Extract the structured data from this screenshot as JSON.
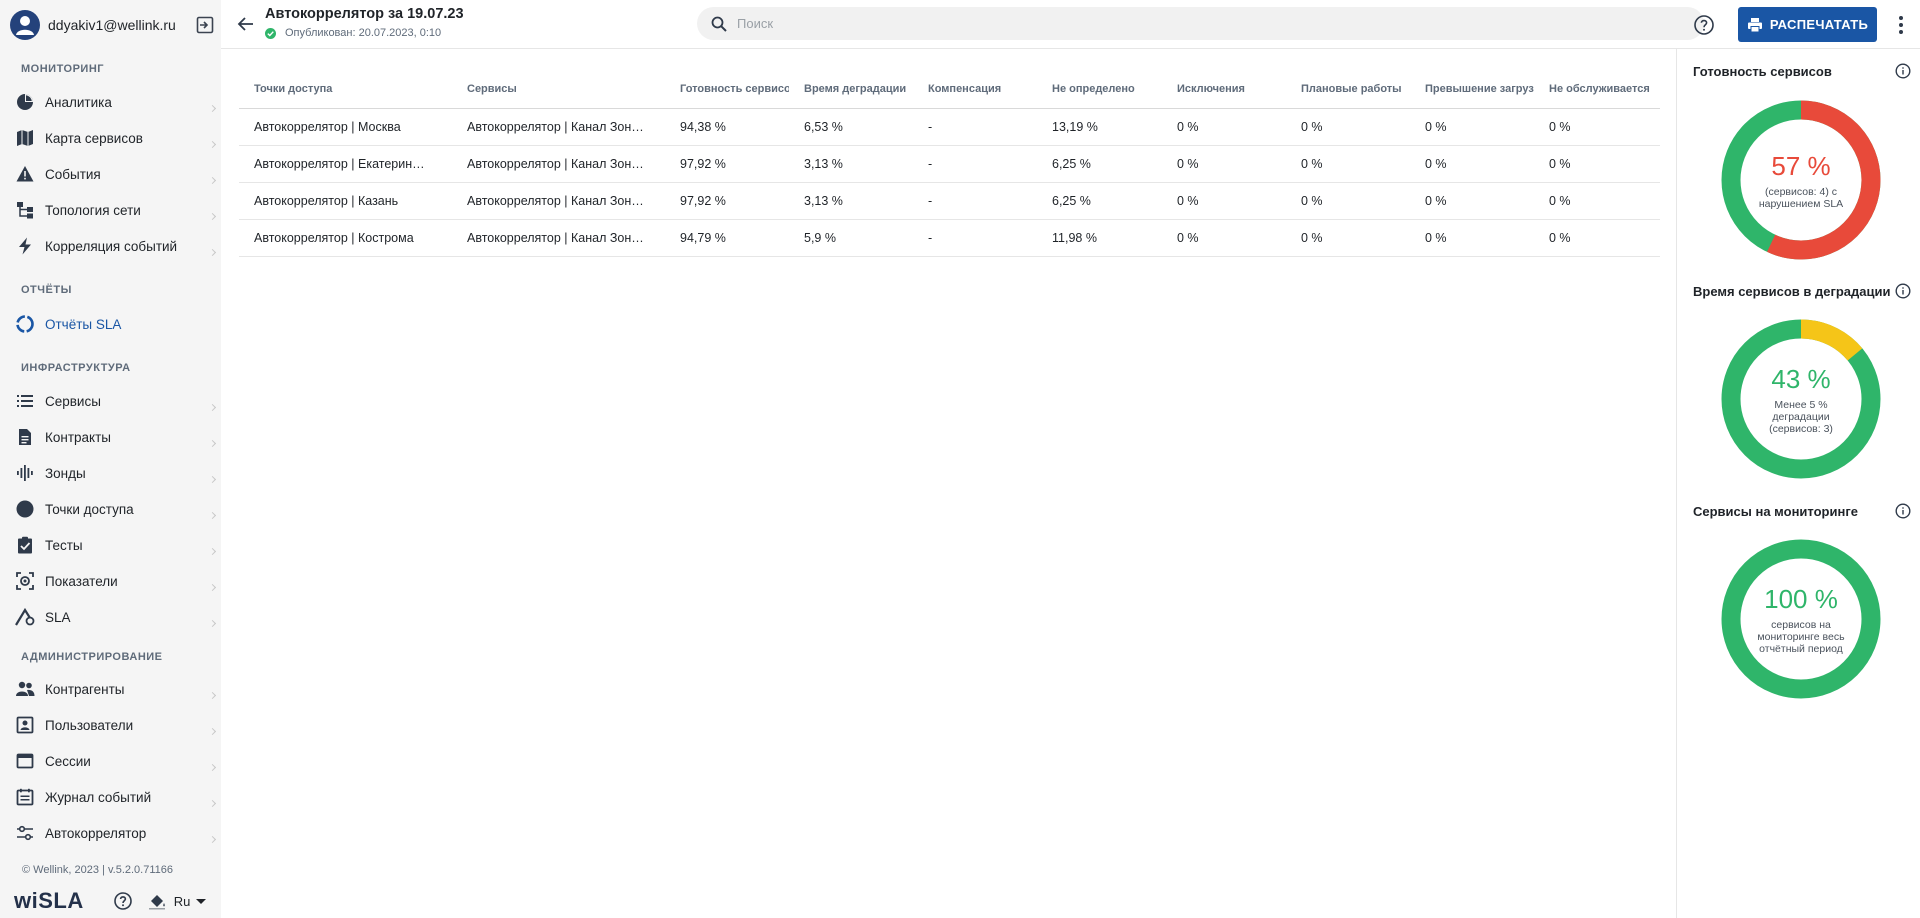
{
  "user": {
    "email": "ddyakiv1@wellink.ru"
  },
  "sidebar": {
    "sections": [
      {
        "title": "МОНИТОРИНГ"
      },
      {
        "title": "ОТЧЁТЫ"
      },
      {
        "title": "ИНФРАСТРУКТУРА"
      },
      {
        "title": "АДМИНИСТРИРОВАНИЕ"
      }
    ],
    "items": [
      {
        "label": "Аналитика",
        "icon": "pie-chart-icon"
      },
      {
        "label": "Карта сервисов",
        "icon": "map-icon"
      },
      {
        "label": "События",
        "icon": "warning-icon"
      },
      {
        "label": "Топология сети",
        "icon": "topology-icon"
      },
      {
        "label": "Корреляция событий",
        "icon": "bolt-icon"
      },
      {
        "label": "Отчёты SLA",
        "icon": "report-ring-icon"
      },
      {
        "label": "Сервисы",
        "icon": "list-icon"
      },
      {
        "label": "Контракты",
        "icon": "document-icon"
      },
      {
        "label": "Зонды",
        "icon": "probe-icon"
      },
      {
        "label": "Точки доступа",
        "icon": "circle-icon"
      },
      {
        "label": "Тесты",
        "icon": "clipboard-check-icon"
      },
      {
        "label": "Показатели",
        "icon": "metrics-icon"
      },
      {
        "label": "SLA",
        "icon": "sla-icon"
      },
      {
        "label": "Контрагенты",
        "icon": "people-icon"
      },
      {
        "label": "Пользователи",
        "icon": "user-card-icon"
      },
      {
        "label": "Сессии",
        "icon": "window-icon"
      },
      {
        "label": "Журнал событий",
        "icon": "calendar-log-icon"
      },
      {
        "label": "Автокоррелятор",
        "icon": "sliders-icon"
      }
    ],
    "active_item": "Отчёты SLA",
    "copyright": "© Wellink, 2023 | v.5.2.0.71166",
    "logo": "wiSLA",
    "language": "Ru"
  },
  "header": {
    "title": "Автокоррелятор за 19.07.23",
    "published": "Опубликован: 20.07.2023, 0:10",
    "search_placeholder": "Поиск",
    "print_label": "РАСПЕЧАТАТЬ"
  },
  "table": {
    "columns": [
      "Точки доступа",
      "Сервисы",
      "Готовность сервисов",
      "Время деградации",
      "Компенсация",
      "Не определено",
      "Исключения",
      "Плановые работы",
      "Превышение загрузки",
      "Не обслуживается"
    ],
    "rows": [
      [
        "Автокоррелятор | Москва",
        "Автокоррелятор | Канал Зон…",
        "94,38 %",
        "6,53 %",
        "-",
        "13,19 %",
        "0 %",
        "0 %",
        "0 %",
        "0 %"
      ],
      [
        "Автокоррелятор | Екатерин…",
        "Автокоррелятор | Канал Зон…",
        "97,92 %",
        "3,13 %",
        "-",
        "6,25 %",
        "0 %",
        "0 %",
        "0 %",
        "0 %"
      ],
      [
        "Автокоррелятор | Казань",
        "Автокоррелятор | Канал Зон…",
        "97,92 %",
        "3,13 %",
        "-",
        "6,25 %",
        "0 %",
        "0 %",
        "0 %",
        "0 %"
      ],
      [
        "Автокоррелятор | Кострома",
        "Автокоррелятор | Канал Зон…",
        "94,79 %",
        "5,9 %",
        "-",
        "11,98 %",
        "0 %",
        "0 %",
        "0 %",
        "0 %"
      ]
    ]
  },
  "panel": {
    "cards": [
      {
        "title": "Готовность сервисов",
        "percent": "57 %",
        "subtitle": "(сервисов: 4) с нарушением SLA",
        "fraction": 0.57,
        "main_color": "#2fb56a",
        "accent_color": "#e84a3a",
        "text_color": "#e84a3a"
      },
      {
        "title": "Время сервисов в деградации",
        "percent": "43 %",
        "subtitle": "Менее 5 % деградации (сервисов: 3)",
        "fraction": 0.14,
        "main_color": "#2fb56a",
        "accent_color": "#f5c518",
        "text_color": "#2fb56a"
      },
      {
        "title": "Сервисы на мониторинге",
        "percent": "100 %",
        "subtitle": "сервисов на мониторинге весь отчётный период",
        "fraction": 0,
        "main_color": "#2fb56a",
        "accent_color": "#2fb56a",
        "text_color": "#2fb56a"
      }
    ]
  },
  "colors": {
    "accent": "#1a56a5",
    "success": "#2fb56a",
    "danger": "#e84a3a",
    "warning": "#f5c518"
  }
}
